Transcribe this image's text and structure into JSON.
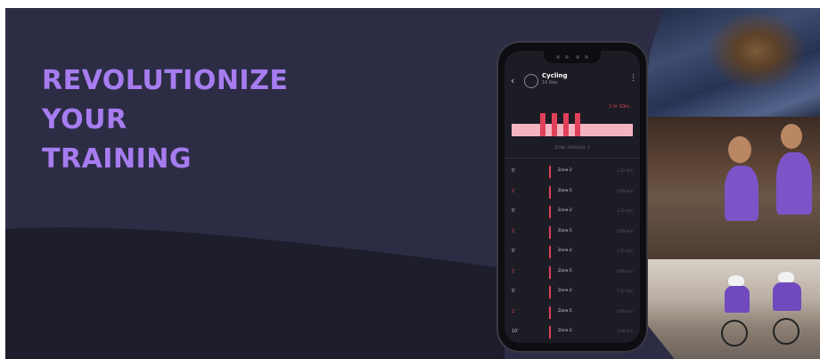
{
  "headline": {
    "line1": "REVOLUTIONIZE",
    "line2": "YOUR",
    "line3": "TRAINING"
  },
  "colors": {
    "background": "#2c2d45",
    "wave": "#1e1d2c",
    "accent": "#a77cf0",
    "zone_bar": "#e0405a",
    "zone_base": "#f3b3c0"
  },
  "phone": {
    "header": {
      "title": "Cycling",
      "subtitle": "10 Nov",
      "back_icon": "chevron-left-icon",
      "activity_icon": "cycling-icon",
      "menu_icon": "more-vertical-icon"
    },
    "chart": {
      "max_label": "1 hr 10m",
      "caption": "ZONE AVERAGE 3"
    },
    "rows": [
      {
        "label": "5'",
        "zone": "Zone 2",
        "value": "1:12 min",
        "pink": false
      },
      {
        "label": "1'",
        "zone": "Zone 5",
        "value": "0:45 min",
        "pink": true
      },
      {
        "label": "5'",
        "zone": "Zone 2",
        "value": "1:12 min",
        "pink": false
      },
      {
        "label": "1'",
        "zone": "Zone 5",
        "value": "0:45 min",
        "pink": true
      },
      {
        "label": "5'",
        "zone": "Zone 2",
        "value": "1:12 min",
        "pink": false
      },
      {
        "label": "1'",
        "zone": "Zone 5",
        "value": "0:45 min",
        "pink": true
      },
      {
        "label": "5'",
        "zone": "Zone 2",
        "value": "1:12 min",
        "pink": false
      },
      {
        "label": "1'",
        "zone": "Zone 5",
        "value": "0:45 min",
        "pink": true
      },
      {
        "label": "10'",
        "zone": "Zone 2",
        "value": "2:30 min",
        "pink": false
      }
    ]
  },
  "photos": {
    "top": "swimmer-photo",
    "middle": "runners-photo",
    "bottom": "cyclists-photo"
  }
}
